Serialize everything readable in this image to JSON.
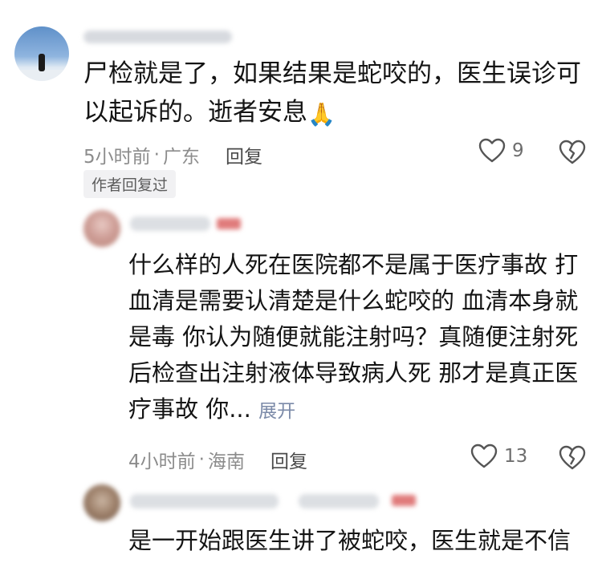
{
  "comments": [
    {
      "text": "尸检就是了，如果结果是蛇咬的，医生误诊可以起诉的。逝者安息",
      "emoji": "🙏",
      "time": "5小时前",
      "location": "广东",
      "reply_label": "回复",
      "likes": "9",
      "badge": "作者回复过"
    },
    {
      "text": "什么样的人死在医院都不是属于医疗事故 打血清是需要认清楚是什么蛇咬的 血清本身就是毒 你认为随便就能注射吗？真随便注射死后检查出注射液体导致病人死 那才是真正医疗事故 你...",
      "expand_label": "展开",
      "time": "4小时前",
      "location": "海南",
      "reply_label": "回复",
      "likes": "13"
    },
    {
      "text": "是一开始跟医生讲了被蛇咬，医生就是不信"
    }
  ],
  "meta_separator": "·",
  "icons": {
    "like": "heart-outline-icon",
    "dislike": "broken-heart-icon",
    "reply_emoji": "folded-hands-icon"
  },
  "colors": {
    "meta_gray": "#8c8c8c",
    "expand_link": "#7b8aa8",
    "badge_bg": "#f1f1f3"
  }
}
